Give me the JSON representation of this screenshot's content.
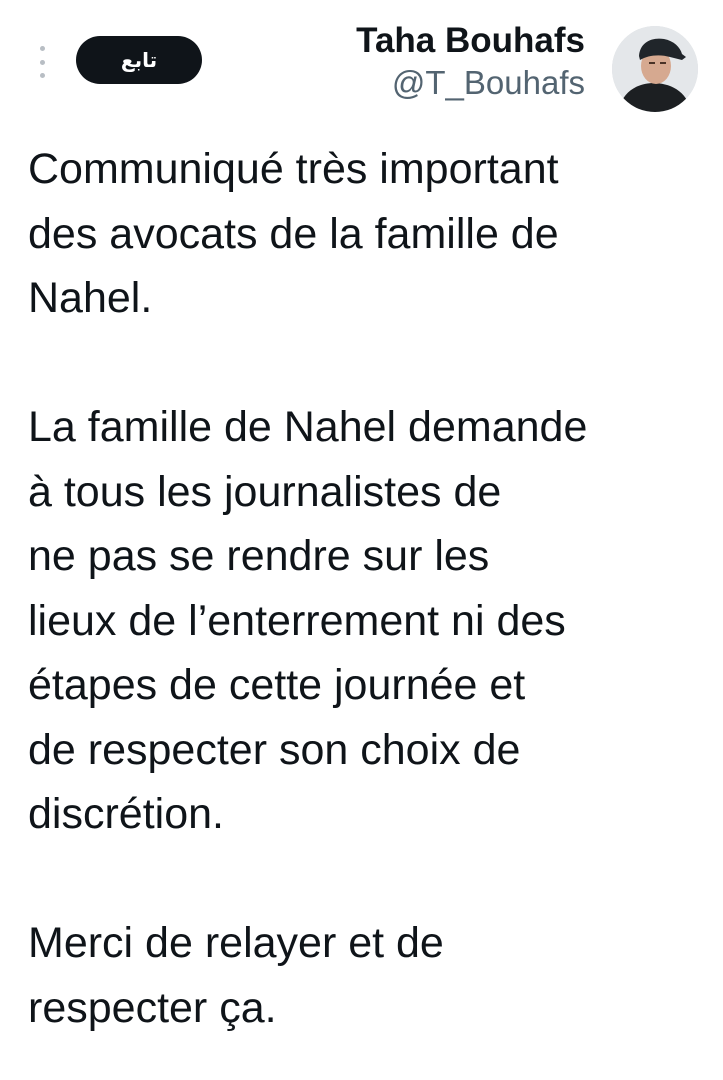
{
  "header": {
    "follow_label": "تابع",
    "display_name": "Taha Bouhafs",
    "handle": "@T_Bouhafs",
    "avatar_icon": "profile-photo",
    "more_icon": "vertical-dots-icon"
  },
  "tweet": {
    "paragraphs": [
      [
        "Communiqué très important",
        "des avocats de la famille de",
        "Nahel."
      ],
      [
        "La famille de Nahel demande",
        "à tous les journalistes de",
        "ne pas se rendre sur les",
        "lieux de l’enterrement ni des",
        "étapes de cette journée et",
        "de respecter son choix de",
        "discrétion."
      ],
      [
        "Merci de relayer et de",
        "respecter ça."
      ]
    ]
  },
  "colors": {
    "text": "#0f1419",
    "secondary_text": "#536471",
    "follow_button_bg": "#0f1419",
    "follow_button_text": "#ffffff"
  }
}
